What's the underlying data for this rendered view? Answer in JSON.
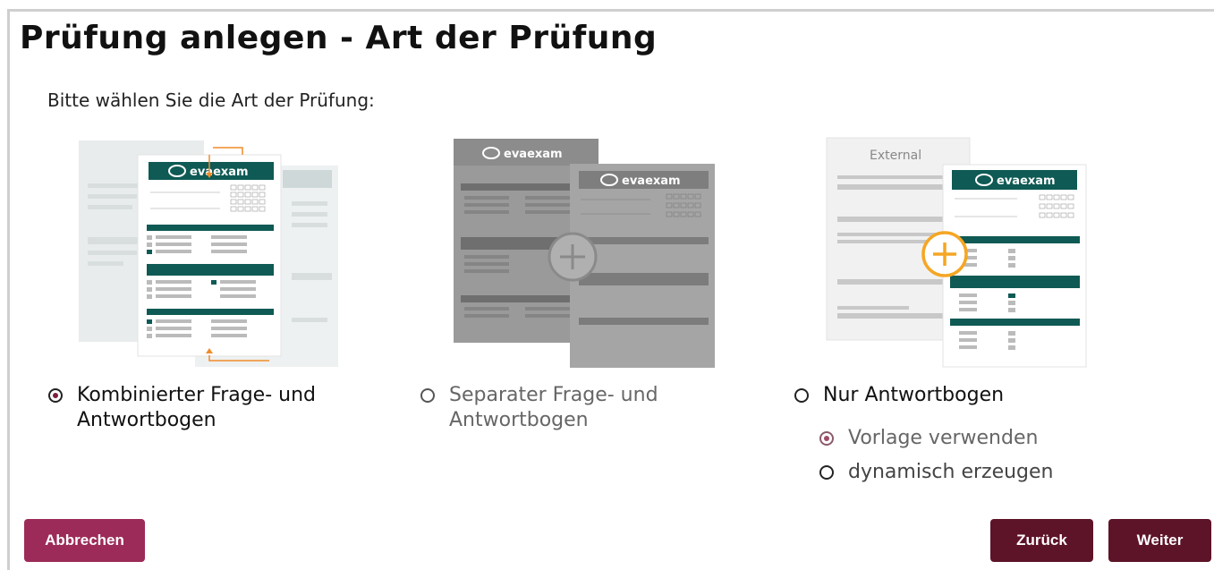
{
  "page": {
    "title": "Prüfung anlegen - Art der Prüfung",
    "subtitle": "Bitte wählen Sie die Art der Prüfung:"
  },
  "brand": {
    "logo_text": "evaexam",
    "accent": "#0f5a54",
    "primary": "#5e1428",
    "cancel": "#9c2b59",
    "highlight": "#f5a623"
  },
  "options": [
    {
      "label_line1": "Kombinierter Frage- und",
      "label_line2": "Antwortbogen",
      "selected": true
    },
    {
      "label_line1": "Separater Frage- und",
      "label_line2": "Antwortbogen",
      "selected": false
    },
    {
      "label_line1": "Nur Antwortbogen",
      "selected": false
    }
  ],
  "sub_options": [
    {
      "label": "Vorlage verwenden",
      "selected": true
    },
    {
      "label": "dynamisch erzeugen",
      "selected": false
    }
  ],
  "illustration3": {
    "back_sheet_title": "External"
  },
  "buttons": {
    "cancel": "Abbrechen",
    "back": "Zurück",
    "next": "Weiter"
  }
}
